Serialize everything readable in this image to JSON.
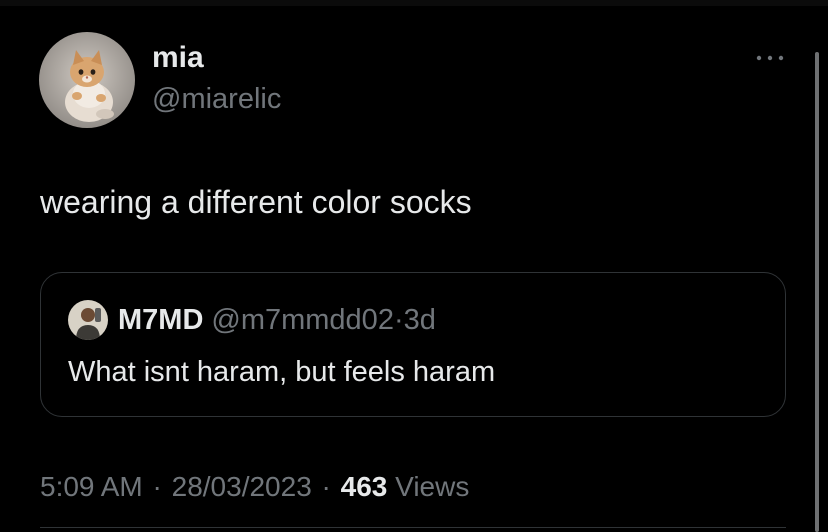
{
  "author": {
    "display_name": "mia",
    "handle": "@miarelic",
    "avatar": "kitten-avatar"
  },
  "tweet": {
    "text": "wearing a different color socks"
  },
  "more_menu": {
    "icon": "more-dots-icon"
  },
  "quote": {
    "display_name": "M7MD",
    "handle": "@m7mmdd02",
    "separator": "·",
    "age": "3d",
    "text": "What isnt haram, but feels haram",
    "avatar": "person-avatar"
  },
  "meta": {
    "time": "5:09 AM",
    "separator": "·",
    "date": "28/03/2023",
    "views_count": "463",
    "views_label": "Views"
  },
  "colors": {
    "background": "#000000",
    "primary_text": "#e7e9ea",
    "secondary_text": "#71767b",
    "border": "#2f3336"
  }
}
